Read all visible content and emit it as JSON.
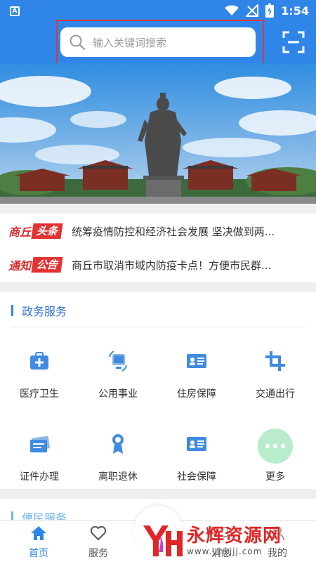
{
  "status_bar": {
    "badge": "A",
    "time": "1:54"
  },
  "search": {
    "placeholder": "输入关键词搜索"
  },
  "news": [
    {
      "tag_left": "商丘",
      "tag_right": "头条",
      "text": "统筹疫情防控和经济社会发展 坚决做到两..."
    },
    {
      "tag_left": "通知",
      "tag_right": "公告",
      "text": "商丘市取消市域内防疫卡点！方便市民群..."
    }
  ],
  "government_services": {
    "title": "政务服务",
    "items": [
      {
        "label": "医疗卫生",
        "icon": "medical-kit-icon"
      },
      {
        "label": "公用事业",
        "icon": "public-utility-icon"
      },
      {
        "label": "住房保障",
        "icon": "housing-card-icon"
      },
      {
        "label": "交通出行",
        "icon": "transport-crop-icon"
      },
      {
        "label": "证件办理",
        "icon": "certificate-icon"
      },
      {
        "label": "离职退休",
        "icon": "retirement-medal-icon"
      },
      {
        "label": "社会保障",
        "icon": "social-security-card-icon"
      },
      {
        "label": "更多",
        "icon": "more-dots-icon"
      }
    ]
  },
  "convenience_services": {
    "title": "便民服务"
  },
  "bottom_nav": [
    {
      "label": "首页",
      "icon": "home-icon",
      "active": true
    },
    {
      "label": "服务",
      "icon": "heart-icon",
      "active": false
    },
    {
      "label": "消息",
      "icon": "message-icon",
      "active": false
    },
    {
      "label": "我的",
      "icon": "profile-icon",
      "active": false
    }
  ],
  "watermark": {
    "title": "永辉资源网",
    "url": "www.yhkjjj.com"
  },
  "colors": {
    "primary": "#2f86e8",
    "headline_red": "#e23232",
    "more_green": "#b9ecca"
  }
}
